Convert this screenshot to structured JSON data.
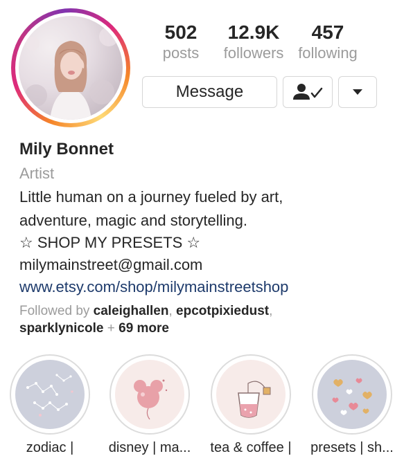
{
  "profile": {
    "name": "Mily Bonnet",
    "category": "Artist",
    "bio_lines": [
      "Little human on a journey fueled by art,",
      "adventure, magic and storytelling.",
      "☆ SHOP MY PRESETS ☆",
      "milymainstreet@gmail.com"
    ],
    "link": "www.etsy.com/shop/milymainstreetshop"
  },
  "stats": [
    {
      "number": "502",
      "label": "posts"
    },
    {
      "number": "12.9K",
      "label": "followers"
    },
    {
      "number": "457",
      "label": "following"
    }
  ],
  "actions": {
    "message_label": "Message",
    "following_icon": "person-check-icon",
    "dropdown_icon": "caret-down-icon"
  },
  "followed_by": {
    "prefix": "Followed by",
    "users": [
      "caleighallen",
      "epcotpixiedust",
      "sparklynicole"
    ],
    "comma": ",",
    "plus": "+",
    "more": "69 more"
  },
  "highlights": [
    {
      "label": "zodiac |",
      "icon": "constellation-icon"
    },
    {
      "label": "disney | ma...",
      "icon": "mickey-balloon-icon"
    },
    {
      "label": "tea & coffee |",
      "icon": "tea-cup-icon"
    },
    {
      "label": "presets | sh...",
      "icon": "hearts-icon"
    }
  ],
  "colors": {
    "link": "#1d3a6b",
    "secondary_text": "#9b9b9b",
    "primary_text": "#262626"
  }
}
